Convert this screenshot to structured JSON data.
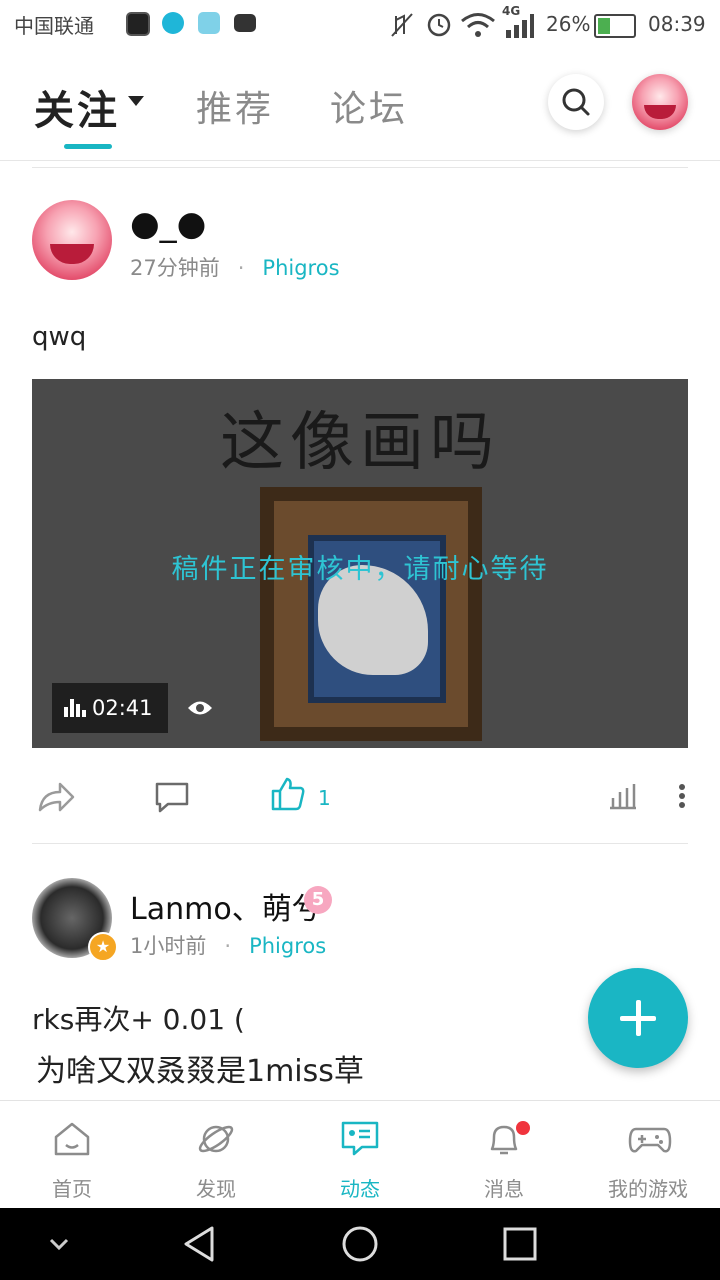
{
  "status_bar": {
    "carrier": "中国联通",
    "signal_label": "4G",
    "battery": "26%",
    "time": "08:39"
  },
  "header": {
    "tabs": [
      {
        "label": "关注",
        "active": true
      },
      {
        "label": "推荐",
        "active": false
      },
      {
        "label": "论坛",
        "active": false
      }
    ],
    "icons": [
      "search-icon",
      "user-avatar"
    ]
  },
  "posts": [
    {
      "username": "●_●",
      "time": "27分钟前",
      "game": "Phigros",
      "text": "qwq",
      "video": {
        "frame_title": "这像画吗",
        "review_notice": "稿件正在审核中，请耐心等待",
        "duration": "02:41"
      },
      "actions": {
        "like_count": "1"
      }
    },
    {
      "username": "Lanmo、萌兮",
      "level_badge": "5",
      "time": "1小时前",
      "game": "Phigros",
      "text_lines": [
        "rks再次+ 0.01 (",
        "为啥又双叒叕是1miss草"
      ]
    }
  ],
  "bottom_nav": [
    {
      "label": "首页",
      "icon": "home-icon"
    },
    {
      "label": "发现",
      "icon": "planet-icon"
    },
    {
      "label": "动态",
      "icon": "feed-icon",
      "active": true
    },
    {
      "label": "消息",
      "icon": "bell-icon",
      "has_dot": true
    },
    {
      "label": "我的游戏",
      "icon": "gamepad-icon"
    }
  ],
  "colors": {
    "accent": "#19b6c3",
    "notify_dot": "#f0343d"
  }
}
